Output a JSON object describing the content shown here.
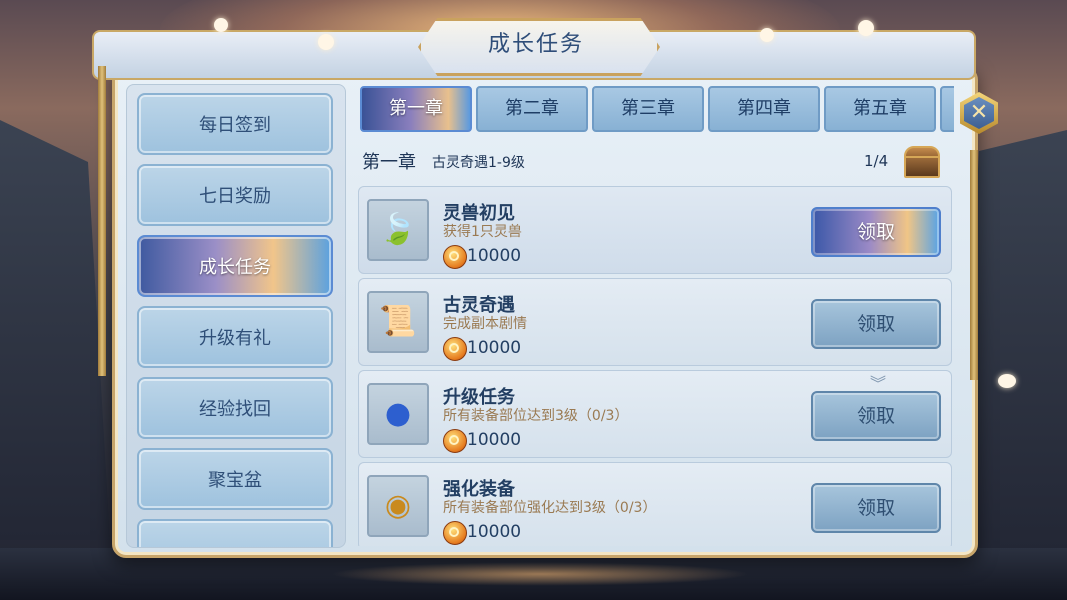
{
  "window": {
    "title": "成长任务"
  },
  "close_icon": "close-icon",
  "sidebar": {
    "items": [
      {
        "label": "每日签到"
      },
      {
        "label": "七日奖励"
      },
      {
        "label": "成长任务",
        "active": true
      },
      {
        "label": "升级有礼"
      },
      {
        "label": "经验找回"
      },
      {
        "label": "聚宝盆"
      },
      {
        "label": ""
      }
    ]
  },
  "tabs": [
    {
      "label": "第一章",
      "active": true
    },
    {
      "label": "第二章"
    },
    {
      "label": "第三章"
    },
    {
      "label": "第四章"
    },
    {
      "label": "第五章"
    }
  ],
  "chapter": {
    "title": "第一章",
    "subtitle": "古灵奇遇1-9级",
    "progress": "1/4",
    "chest_icon": "treasure-chest-icon"
  },
  "tasks": [
    {
      "title": "灵兽初见",
      "desc": "获得1只灵兽",
      "reward": "10000",
      "button": "领取",
      "claimable": true,
      "icon": "leaf-icon"
    },
    {
      "title": "古灵奇遇",
      "desc": "完成副本剧情",
      "reward": "10000",
      "button": "领取",
      "claimable": false,
      "icon": "scroll-icon"
    },
    {
      "title": "升级任务",
      "desc": "所有装备部位达到3级（0/3）",
      "reward": "10000",
      "button": "领取",
      "claimable": false,
      "icon": "orb-shell-icon"
    },
    {
      "title": "强化装备",
      "desc": "所有装备部位强化达到3级（0/3）",
      "reward": "10000",
      "button": "领取",
      "claimable": false,
      "icon": "gold-medal-icon"
    }
  ],
  "currency_icon": "coin-icon",
  "colors": {
    "accent_active": "#5b8bd3",
    "panel_bg": "#e8f0f7",
    "text_dark": "#233f63",
    "desc_brown": "#9a7a52",
    "gold_border": "#c7a56a"
  }
}
